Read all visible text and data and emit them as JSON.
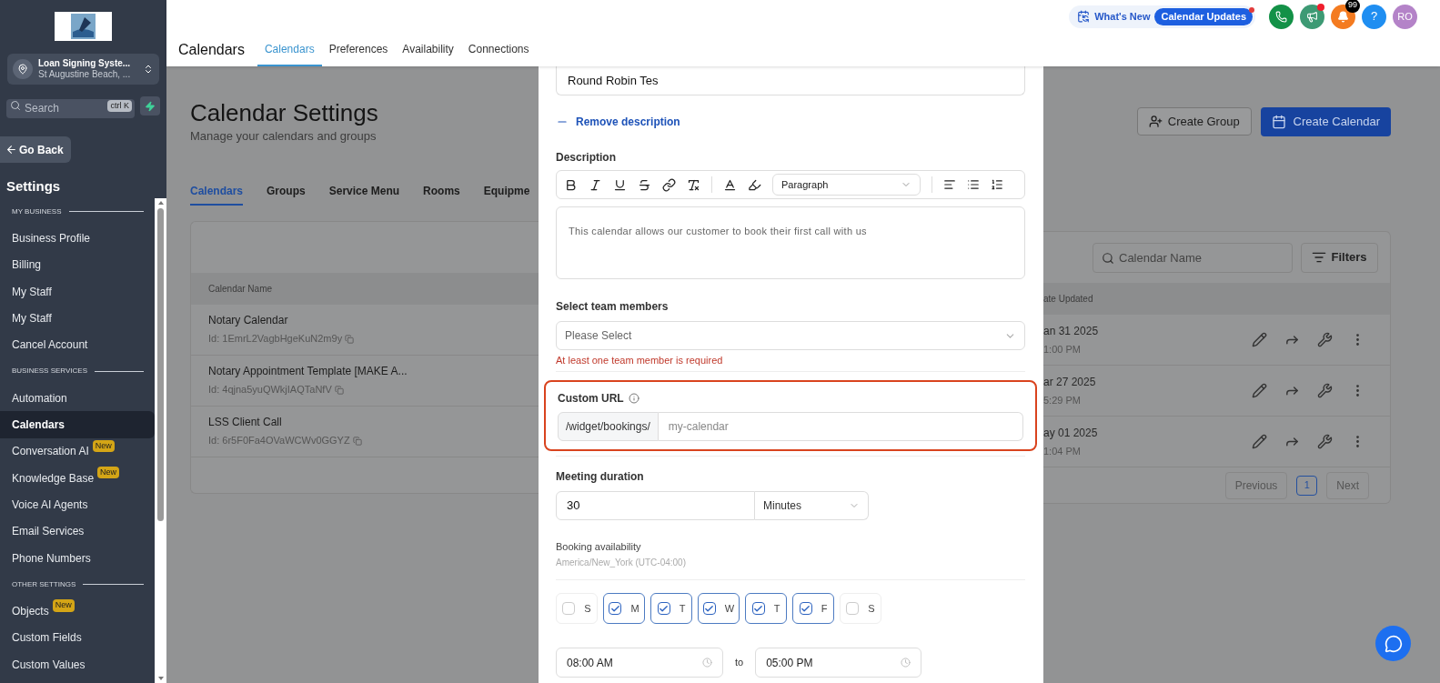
{
  "sidebar": {
    "account": {
      "name": "Loan Signing Syste...",
      "location": "St Augustine Beach, ..."
    },
    "search": {
      "placeholder": "Search",
      "shortcut": "ctrl K"
    },
    "back_button": "Go Back",
    "title": "Settings",
    "sections": [
      {
        "heading": "MY BUSINESS",
        "items": [
          {
            "label": "Business Profile",
            "selected": false
          },
          {
            "label": "Billing",
            "selected": false
          },
          {
            "label": "My Staff",
            "selected": false
          },
          {
            "label": "My Staff",
            "selected": false
          },
          {
            "label": "Cancel Account",
            "selected": false
          }
        ]
      },
      {
        "heading": "BUSINESS SERVICES",
        "items": [
          {
            "label": "Automation",
            "selected": false
          },
          {
            "label": "Calendars",
            "selected": true
          },
          {
            "label": "Conversation AI",
            "selected": false,
            "badge": "New"
          },
          {
            "label": "Knowledge Base",
            "selected": false,
            "badge": "New"
          },
          {
            "label": "Voice AI Agents",
            "selected": false
          },
          {
            "label": "Email Services",
            "selected": false
          },
          {
            "label": "Phone Numbers",
            "selected": false
          }
        ]
      },
      {
        "heading": "OTHER SETTINGS",
        "items": [
          {
            "label": "Objects",
            "selected": false,
            "badge": "New"
          },
          {
            "label": "Custom Fields",
            "selected": false
          },
          {
            "label": "Custom Values",
            "selected": false
          }
        ]
      }
    ]
  },
  "header": {
    "title": "Calendars",
    "tabs": [
      {
        "label": "Calendars",
        "selected": true
      },
      {
        "label": "Preferences",
        "selected": false
      },
      {
        "label": "Availability",
        "selected": false
      },
      {
        "label": "Connections",
        "selected": false
      }
    ],
    "whats_new": {
      "label": "What's New",
      "badge": "Calendar Updates"
    },
    "notification_count": "99",
    "help": "?",
    "avatar": "RO"
  },
  "page": {
    "title": "Calendar Settings",
    "subtitle": "Manage your calendars and groups",
    "tabs": [
      {
        "label": "Calendars",
        "selected": true
      },
      {
        "label": "Groups",
        "selected": false
      },
      {
        "label": "Service Menu",
        "selected": false
      },
      {
        "label": "Rooms",
        "selected": false
      },
      {
        "label": "Equipme",
        "selected": false
      }
    ],
    "create_group": "Create Group",
    "create_calendar": "Create Calendar",
    "table": {
      "search": {
        "placeholder": "Calendar Name"
      },
      "filters": "Filters",
      "columns": [
        "Calendar Name",
        "ate Updated"
      ],
      "rows": [
        {
          "name": "Notary Calendar",
          "id": "Id: 1EmrL2VagbHgeKuN2m9y",
          "date": "an 31 2025",
          "time": "1:00 PM"
        },
        {
          "name": "Notary Appointment Template [MAKE A...",
          "id": "Id: 4qjna5yuQWkjIAQTaNfV",
          "date": "ar 27 2025",
          "time": "5:29 PM"
        },
        {
          "name": "LSS Client Call",
          "id": "Id: 6r5F0Fa4OVaWCWv0GGYZ",
          "date": "ay 01 2025",
          "time": "1:04 PM"
        }
      ],
      "pagination": {
        "previous": "Previous",
        "page": "1",
        "next": "Next"
      }
    }
  },
  "modal": {
    "name_value": "Round Robin Tes",
    "remove_description": "Remove description",
    "description_label": "Description",
    "block_format": "Paragraph",
    "description_value": "This calendar allows our customer to book their first call with us",
    "team_label": "Select team members",
    "team_placeholder": "Please Select",
    "team_error": "At least one team member is required",
    "custom_url": {
      "label": "Custom URL",
      "prefix": "/widget/bookings/",
      "placeholder": "my-calendar",
      "highlighted": true
    },
    "duration_label": "Meeting duration",
    "duration_value": "30",
    "duration_unit": "Minutes",
    "availability_label": "Booking availability",
    "timezone": "America/New_York (UTC-04:00)",
    "days": [
      {
        "label": "S",
        "checked": false
      },
      {
        "label": "M",
        "checked": true
      },
      {
        "label": "T",
        "checked": true
      },
      {
        "label": "W",
        "checked": true
      },
      {
        "label": "T",
        "checked": true
      },
      {
        "label": "F",
        "checked": true
      },
      {
        "label": "S",
        "checked": false
      }
    ],
    "start_time": "08:00 AM",
    "separator": "to",
    "end_time": "05:00 PM"
  }
}
